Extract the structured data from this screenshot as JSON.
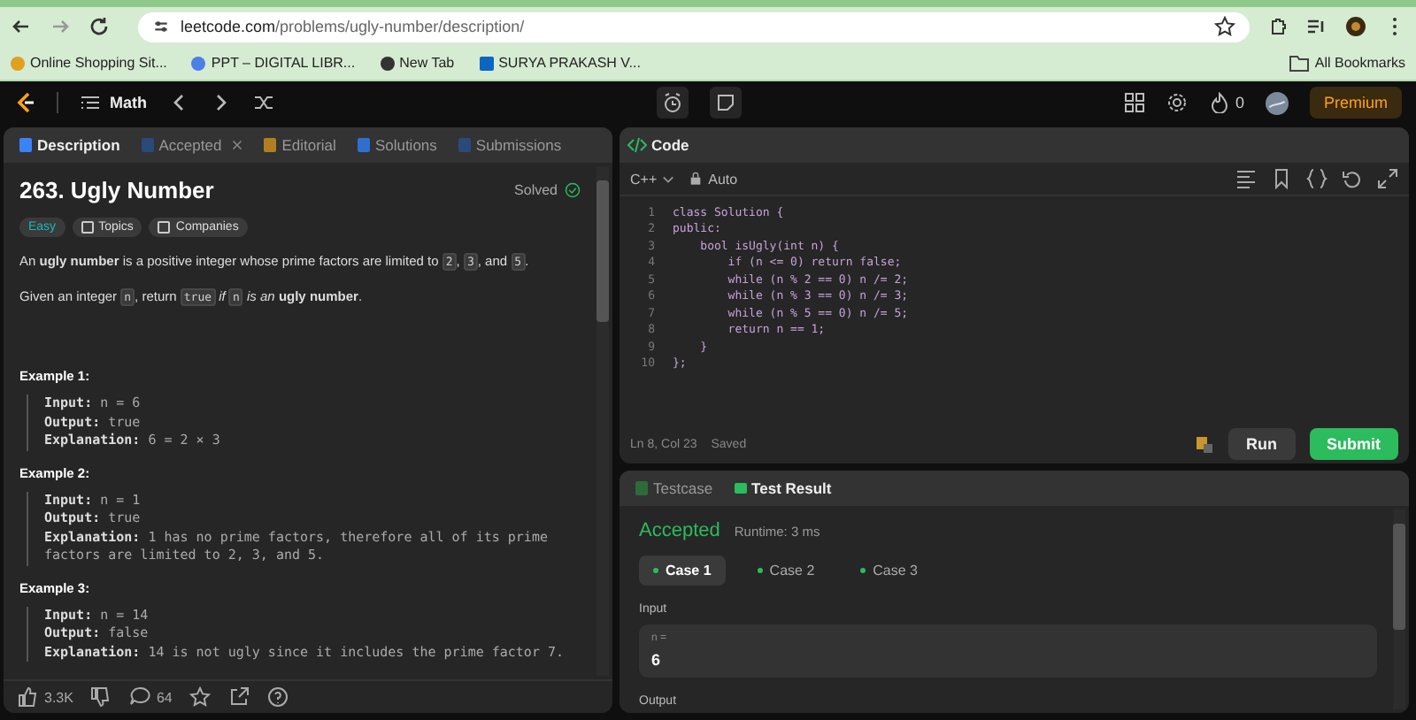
{
  "browser": {
    "url_host": "leetcode.com",
    "url_path": "/problems/ugly-number/description/",
    "bookmarks": [
      "Online Shopping Sit...",
      "PPT – DIGITAL LIBR...",
      "New Tab",
      "SURYA PRAKASH V..."
    ],
    "all_bookmarks": "All Bookmarks"
  },
  "header": {
    "list": "Math",
    "streak": "0",
    "premium": "Premium"
  },
  "left_tabs": [
    {
      "label": "Description",
      "selected": true
    },
    {
      "label": "Accepted",
      "selected": false,
      "closable": true
    },
    {
      "label": "Editorial",
      "selected": false
    },
    {
      "label": "Solutions",
      "selected": false
    },
    {
      "label": "Submissions",
      "selected": false
    }
  ],
  "problem": {
    "title": "263. Ugly Number",
    "status": "Solved",
    "difficulty": "Easy",
    "tags": [
      "Topics",
      "Companies"
    ],
    "paragraphs": [
      [
        {
          "kind": "text",
          "text": "An **ugly number** is a positive integer whose prime factors are limited to "
        },
        {
          "kind": "code",
          "text": "2"
        },
        {
          "kind": "text",
          "text": ", "
        },
        {
          "kind": "code",
          "text": "3"
        },
        {
          "kind": "text",
          "text": ", and "
        },
        {
          "kind": "code",
          "text": "5"
        },
        {
          "kind": "text",
          "text": "."
        }
      ],
      [
        {
          "kind": "text",
          "text": "Given an integer "
        },
        {
          "kind": "code",
          "text": "n"
        },
        {
          "kind": "text",
          "text": ", return "
        },
        {
          "kind": "code",
          "text": "true"
        },
        {
          "kind": "text",
          "text": " *if* "
        },
        {
          "kind": "code",
          "text": "n"
        },
        {
          "kind": "text",
          "text": " *is an* **ugly number**."
        }
      ]
    ],
    "examples": [
      {
        "title": "Example 1:",
        "lines": [
          {
            "label": "Input:",
            "value": "n = 6"
          },
          {
            "label": "Output:",
            "value": "true"
          },
          {
            "label": "Explanation:",
            "value": "6 = 2 × 3"
          }
        ]
      },
      {
        "title": "Example 2:",
        "lines": [
          {
            "label": "Input:",
            "value": "n = 1"
          },
          {
            "label": "Output:",
            "value": "true"
          },
          {
            "label": "Explanation:",
            "value": "1 has no prime factors, therefore all of its prime factors are limited to 2, 3, and 5."
          }
        ]
      },
      {
        "title": "Example 3:",
        "lines": [
          {
            "label": "Input:",
            "value": "n = 14"
          },
          {
            "label": "Output:",
            "value": "false"
          },
          {
            "label": "Explanation:",
            "value": "14 is not ugly since it includes the prime factor 7."
          }
        ]
      }
    ],
    "likes": "3.3K",
    "comments": "64"
  },
  "code": {
    "title": "Code",
    "language": "C++",
    "mode": "Auto",
    "lines": [
      {
        "no": "1",
        "text": "class Solution {"
      },
      {
        "no": "2",
        "text": "public:"
      },
      {
        "no": "3",
        "text": "    bool isUgly(int n) {"
      },
      {
        "no": "4",
        "text": "        if (n <= 0) return false;"
      },
      {
        "no": "5",
        "text": "        while (n % 2 == 0) n /= 2;"
      },
      {
        "no": "6",
        "text": "        while (n % 3 == 0) n /= 3;"
      },
      {
        "no": "7",
        "text": "        while (n % 5 == 0) n /= 5;"
      },
      {
        "no": "8",
        "text": "        return n == 1;"
      },
      {
        "no": "9",
        "text": "    }"
      },
      {
        "no": "10",
        "text": "};"
      }
    ],
    "cursor": "Ln 8, Col 23",
    "saved": "Saved",
    "run": "Run",
    "submit": "Submit"
  },
  "result_tabs": [
    {
      "label": "Testcase",
      "selected": false
    },
    {
      "label": "Test Result",
      "selected": true
    }
  ],
  "result": {
    "verdict": "Accepted",
    "runtime": "Runtime: 3 ms",
    "cases": [
      {
        "label": "Case 1",
        "selected": true
      },
      {
        "label": "Case 2",
        "selected": false
      },
      {
        "label": "Case 3",
        "selected": false
      }
    ],
    "input_label": "Input",
    "var": "n =",
    "value": "6",
    "output_label": "Output"
  }
}
